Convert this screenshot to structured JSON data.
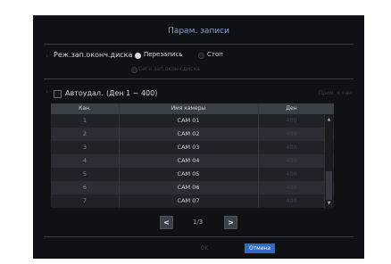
{
  "dialog": {
    "title": "Парам. записи"
  },
  "disk_full_mode": {
    "label": "Реж.зап.оконч.диска",
    "options": [
      {
        "label": "Перезапись",
        "selected": true
      },
      {
        "label": "Стоп",
        "selected": false
      }
    ],
    "sub_option": "Сигн.зап.оконч.диска"
  },
  "auto_delete": {
    "label": "Автоудал.",
    "range": "(Ден 1 ~ 400)",
    "checked": false,
    "apply_all_label": "Прим. к кан."
  },
  "table": {
    "headers": [
      "Кан.",
      "Имя камеры",
      "Ден"
    ],
    "rows": [
      {
        "ch": "1",
        "name": "CAM 01",
        "days": "400"
      },
      {
        "ch": "2",
        "name": "CAM 02",
        "days": "400"
      },
      {
        "ch": "3",
        "name": "CAM 03",
        "days": "400"
      },
      {
        "ch": "4",
        "name": "CAM 04",
        "days": "400"
      },
      {
        "ch": "5",
        "name": "CAM 05",
        "days": "400"
      },
      {
        "ch": "6",
        "name": "CAM 06",
        "days": "400"
      },
      {
        "ch": "7",
        "name": "CAM 07",
        "days": "400"
      }
    ]
  },
  "pagination": {
    "prev": "<",
    "next": ">",
    "page_text": "1/3"
  },
  "buttons": {
    "ok": "OK",
    "cancel": "Отмена"
  },
  "colors": {
    "dialog_bg": "#101114",
    "title": "#7fa0d8",
    "header_bg": "#3b3f46",
    "accent": "#2f6ac4"
  }
}
